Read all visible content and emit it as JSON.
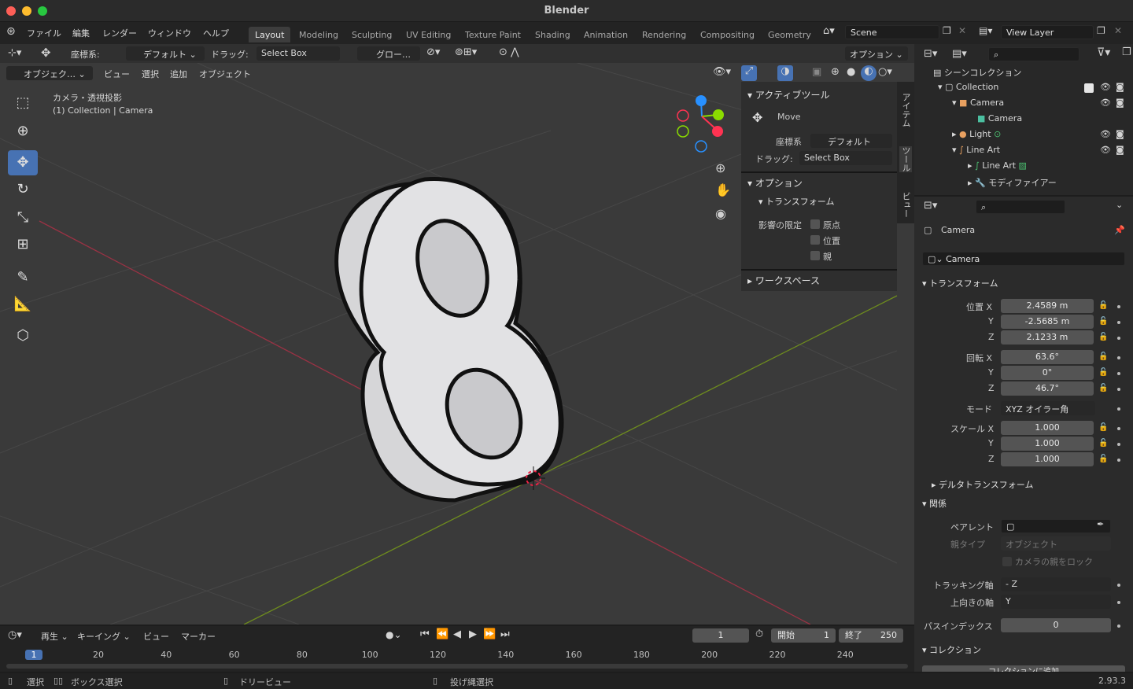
{
  "app": {
    "title": "Blender",
    "version": "2.93.3"
  },
  "menu": [
    "ファイル",
    "編集",
    "レンダー",
    "ウィンドウ",
    "ヘルプ"
  ],
  "workspaces": [
    "Layout",
    "Modeling",
    "Sculpting",
    "UV Editing",
    "Texture Paint",
    "Shading",
    "Animation",
    "Rendering",
    "Compositing",
    "Geometry"
  ],
  "scene": {
    "name": "Scene",
    "view_layer": "View Layer"
  },
  "viewport_header": {
    "coord_label": "座標系:",
    "coord_value": "デフォルト",
    "drag_label": "ドラッグ:",
    "drag_value": "Select Box",
    "pivot": "グロー…",
    "options": "オプション",
    "mode": "オブジェク…",
    "view": "ビュー",
    "select": "選択",
    "add": "追加",
    "object": "オブジェクト"
  },
  "viewport_info": {
    "line1": "カメラ・透視投影",
    "line2": "(1) Collection | Camera"
  },
  "npanel": {
    "active_tool": "アクティブツール",
    "tool_name": "Move",
    "coord_label": "座標系",
    "coord_value": "デフォルト",
    "drag_label": "ドラッグ:",
    "drag_value": "Select Box",
    "options": "オプション",
    "transform": "トランスフォーム",
    "affect_only": "影響の限定",
    "origin": "原点",
    "location": "位置",
    "parent": "親",
    "workspace": "ワークスペース",
    "tabs": [
      "アイテム",
      "ツール",
      "ビュー"
    ]
  },
  "outliner": {
    "root": "シーンコレクション",
    "rows": [
      "Collection",
      "Camera",
      "Camera",
      "Light",
      "Line Art",
      "Line Art",
      "モディファイアー"
    ]
  },
  "properties": {
    "object_name": "Camera",
    "object_field": "Camera",
    "transform_title": "トランスフォーム",
    "location_label": "位置 X",
    "location": [
      "2.4589 m",
      "-2.5685 m",
      "2.1233 m"
    ],
    "rotation_label": "回転 X",
    "rotation": [
      "63.6°",
      "0°",
      "46.7°"
    ],
    "mode_label": "モード",
    "mode_value": "XYZ オイラー角",
    "scale_label": "スケール X",
    "scale": [
      "1.000",
      "1.000",
      "1.000"
    ],
    "axis_y": "Y",
    "axis_z": "Z",
    "delta": "デルタトランスフォーム",
    "relations": "関係",
    "parent_label": "ペアレント",
    "parent_type_label": "親タイプ",
    "parent_type_value": "オブジェクト",
    "lock_camera": "カメラの親をロック",
    "track_axis_label": "トラッキング軸",
    "track_axis_value": "- Z",
    "up_axis_label": "上向きの軸",
    "up_axis_value": "Y",
    "pass_index_label": "パスインデックス",
    "pass_index_value": "0",
    "collection": "コレクション",
    "add_to_collection": "コレクションに追加"
  },
  "timeline": {
    "playback": "再生",
    "keying": "キーイング",
    "view": "ビュー",
    "marker": "マーカー",
    "current_frame": "1",
    "start_label": "開始",
    "start": "1",
    "end_label": "終了",
    "end": "250",
    "ticks": [
      "1",
      "20",
      "40",
      "60",
      "80",
      "100",
      "120",
      "140",
      "160",
      "180",
      "200",
      "220",
      "240"
    ]
  },
  "statusbar": {
    "select": "選択",
    "box_select": "ボックス選択",
    "dolly": "ドリービュー",
    "lasso": "投げ縄選択"
  },
  "colors": {
    "accent": "#4772b3",
    "x_axis": "#ff3352",
    "y_axis": "#8bdc00",
    "z_axis": "#2890ff"
  }
}
